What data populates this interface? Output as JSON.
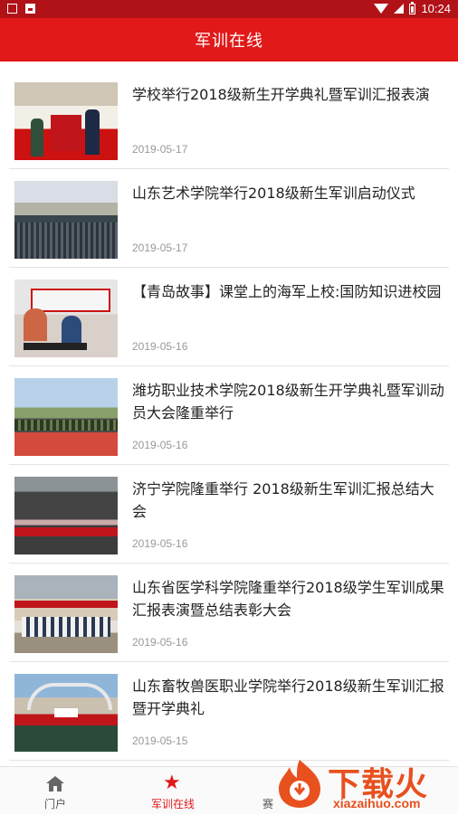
{
  "status_bar": {
    "time": "10:24",
    "left_icons": [
      "notification-icon",
      "image-icon"
    ],
    "right_icons": [
      "wifi-icon",
      "signal-icon",
      "battery-icon"
    ]
  },
  "app_bar": {
    "title": "军训在线"
  },
  "news": [
    {
      "title": "学校举行2018级新生开学典礼暨军训汇报表演",
      "date": "2019-05-17"
    },
    {
      "title": "山东艺术学院举行2018级新生军训启动仪式",
      "date": "2019-05-17"
    },
    {
      "title": "【青岛故事】课堂上的海军上校:国防知识进校园",
      "date": "2019-05-16"
    },
    {
      "title": "潍坊职业技术学院2018级新生开学典礼暨军训动员大会隆重举行",
      "date": "2019-05-16"
    },
    {
      "title": "济宁学院隆重举行 2018级新生军训汇报总结大会",
      "date": "2019-05-16"
    },
    {
      "title": "山东省医学科学院隆重举行2018级学生军训成果汇报表演暨总结表彰大会",
      "date": "2019-05-16"
    },
    {
      "title": "山东畜牧兽医职业学院举行2018级新生军训汇报暨开学典礼",
      "date": "2019-05-15"
    }
  ],
  "bottom_nav": {
    "items": [
      {
        "label": "门户",
        "icon": "home-icon"
      },
      {
        "label": "军训在线",
        "icon": "star-icon",
        "active": true
      }
    ],
    "partial_label": "赛"
  },
  "watermark": {
    "text": "下载火",
    "url": "xiazaihuo.com"
  },
  "colors": {
    "status_bar": "#b01217",
    "app_bar": "#e11919",
    "active_nav": "#e11919",
    "watermark": "#e8501e"
  }
}
